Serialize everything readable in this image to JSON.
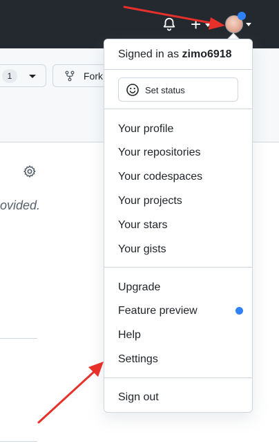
{
  "header": {
    "bell_icon": "bell-icon",
    "plus_icon": "plus-icon",
    "plus_symbol": "+",
    "avatar_icon": "avatar"
  },
  "repo": {
    "watch_count": "1",
    "fork_label": "Fork",
    "description_fragment": "ovided."
  },
  "dropdown": {
    "signed_in_prefix": "Signed in as ",
    "username": "zimo6918",
    "set_status": "Set status",
    "group1": [
      "Your profile",
      "Your repositories",
      "Your codespaces",
      "Your projects",
      "Your stars",
      "Your gists"
    ],
    "group2": [
      "Upgrade",
      "Feature preview",
      "Help",
      "Settings"
    ],
    "sign_out": "Sign out"
  },
  "colors": {
    "header_bg": "#24292f",
    "accent_blue": "#2f81f7",
    "annotation_red": "#e8302a"
  }
}
